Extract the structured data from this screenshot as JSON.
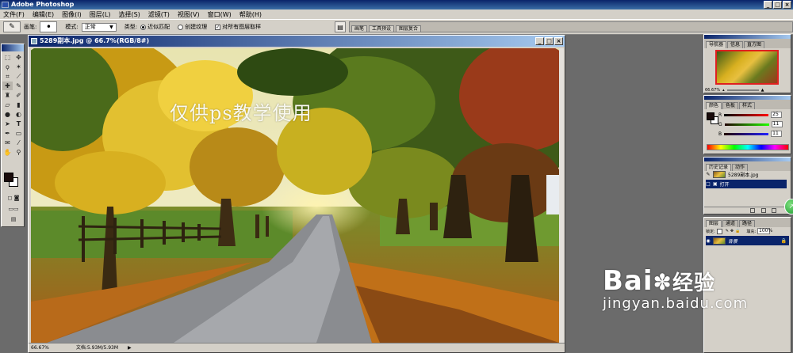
{
  "app": {
    "title": "Adobe Photoshop"
  },
  "menu": [
    "文件(F)",
    "编辑(E)",
    "图像(I)",
    "图层(L)",
    "选择(S)",
    "滤镜(T)",
    "视图(V)",
    "窗口(W)",
    "帮助(H)"
  ],
  "options": {
    "brush_label": "画笔:",
    "brush_size": "•",
    "mode_label": "模式:",
    "mode_value": "正常",
    "type_label": "类型:",
    "type_proximity": "近似匹配",
    "type_texture": "创建纹理",
    "sample_all": "对所有图层取样",
    "well_tabs": [
      "画笔",
      "工具预设",
      "图层复合"
    ]
  },
  "document": {
    "title": "5289副本.jpg @ 66.7%(RGB/8#)",
    "zoom": "66.67%",
    "doc_size": "文档:5.93M/5.93M",
    "watermark": "仅供ps教学使用"
  },
  "navigator": {
    "tabs": [
      "导航器",
      "信息",
      "直方图"
    ],
    "zoom": "66.67%"
  },
  "color": {
    "tabs": [
      "颜色",
      "色板",
      "样式"
    ],
    "channels": [
      {
        "label": "R",
        "value": "25"
      },
      {
        "label": "G",
        "value": "11"
      },
      {
        "label": "B",
        "value": "11"
      }
    ],
    "foreground": "#190b0b"
  },
  "history": {
    "tabs": [
      "历史记录",
      "动作"
    ],
    "snapshot_label": "5289副本.jpg",
    "items": [
      "打开"
    ]
  },
  "layers": {
    "tabs": [
      "图层",
      "通道",
      "路径"
    ],
    "lock_label": "锁定:",
    "fill_label": "填充:",
    "fill_value": "100%",
    "items": [
      "背景"
    ]
  },
  "baidu": {
    "logo": "Bai",
    "logo_suffix": "经验",
    "url": "jingyan.baidu.com"
  },
  "icons": {
    "toolbox": [
      "marquee-icon",
      "move-icon",
      "lasso-icon",
      "magic-wand-icon",
      "crop-icon",
      "slice-icon",
      "healing-icon",
      "brush-icon",
      "stamp-icon",
      "history-brush-icon",
      "eraser-icon",
      "gradient-icon",
      "blur-icon",
      "dodge-icon",
      "path-select-icon",
      "type-icon",
      "pen-icon",
      "shape-icon",
      "notes-icon",
      "eyedropper-icon",
      "hand-icon",
      "zoom-icon"
    ]
  }
}
